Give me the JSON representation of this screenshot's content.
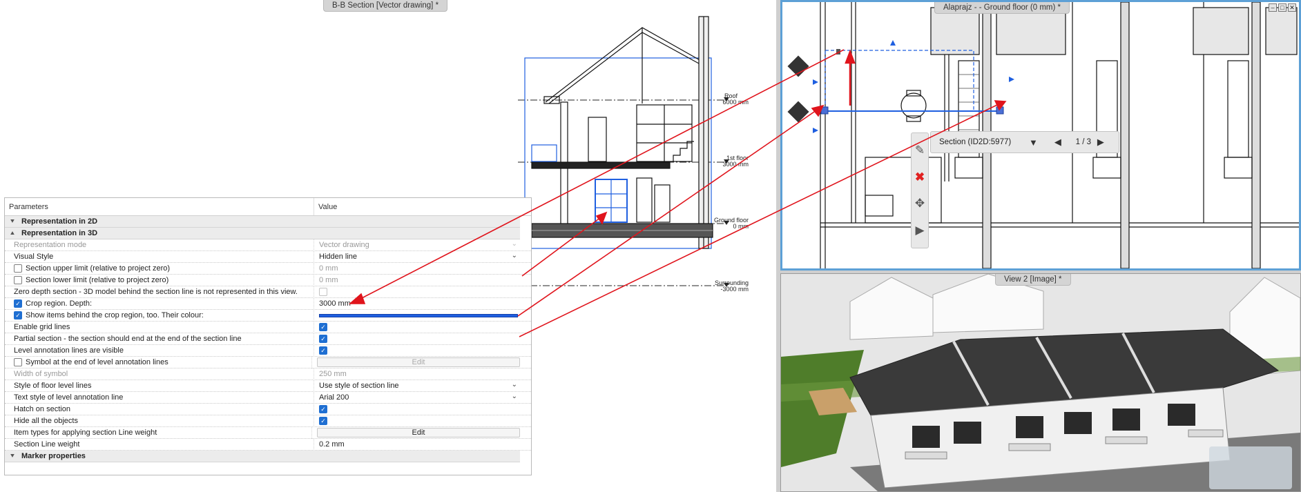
{
  "tabs": {
    "section": "B-B Section [Vector drawing] *",
    "plan": "Alaprajz  -  - Ground floor (0 mm) *",
    "image": "View 2 [Image] *"
  },
  "levels": {
    "roof_name": "Roof",
    "roof_value": "6000 mm",
    "first_name": "1st floor",
    "first_value": "3000 mm",
    "ground_name": "Ground floor",
    "ground_value": "0 mm",
    "surr_name": "Surrounding",
    "surr_value": "-3000 mm"
  },
  "params": {
    "header_param": "Parameters",
    "header_value": "Value",
    "group_2d": "Representation in 2D",
    "group_3d": "Representation in 3D",
    "group_marker": "Marker properties",
    "rows": [
      {
        "label": "Representation mode",
        "value": "Vector drawing"
      },
      {
        "label": "Visual Style",
        "value": "Hidden line"
      },
      {
        "label": "Section upper limit (relative to project zero)",
        "value": "0 mm"
      },
      {
        "label": "Section lower limit (relative to project zero)",
        "value": "0 mm"
      },
      {
        "label": "Zero depth section - 3D model behind the section line is not represented in this view.",
        "value": ""
      },
      {
        "label": "Crop region. Depth:",
        "value": "3000 mm"
      },
      {
        "label": "Show items behind the crop region, too. Their colour:",
        "value": ""
      },
      {
        "label": "Enable grid lines",
        "value": ""
      },
      {
        "label": "Partial section - the section should end at the end of the section line",
        "value": ""
      },
      {
        "label": "Level annotation lines are visible",
        "value": ""
      },
      {
        "label": "Symbol at the end of level annotation lines",
        "value": "Edit"
      },
      {
        "label": "Width of symbol",
        "value": "250 mm"
      },
      {
        "label": "Style of floor level lines",
        "value": "Use style of section line"
      },
      {
        "label": "Text style of level annotation line",
        "value": "Arial 200"
      },
      {
        "label": "Hatch on section",
        "value": ""
      },
      {
        "label": "Hide all the objects",
        "value": ""
      },
      {
        "label": "Item types for applying section Line weight",
        "value": "Edit"
      },
      {
        "label": "Section Line weight",
        "value": "0.2 mm"
      }
    ]
  },
  "plan_popup": {
    "section_label": "Section (ID2D:5977)",
    "page": "1 / 3"
  },
  "icons": {
    "edit": "pencil-icon",
    "delete": "delete-x-icon",
    "move": "move-arrows-icon",
    "expand": "expand-triangle-icon"
  },
  "colors": {
    "accent_blue": "#1f5fe0",
    "arrow_red": "#e0141c",
    "active_border": "#5da0d6"
  }
}
